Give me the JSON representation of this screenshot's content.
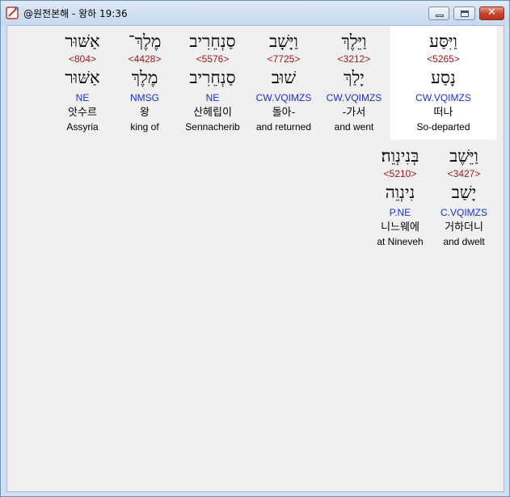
{
  "window": {
    "title": "@원전본해 - 왕하 19:36",
    "close_glyph": "✕"
  },
  "verse_words": [
    {
      "hebrew": "וַיִּסַּע",
      "strong": "<5265>",
      "lemma": "נָסַע",
      "morph": "CW.VQIMZS",
      "korean": "떠나",
      "english": "So-departed"
    },
    {
      "hebrew": "וַיֵּלֶךְ",
      "strong": "<3212>",
      "lemma": "יָלַךְ",
      "morph": "CW.VQIMZS",
      "korean": "-가서",
      "english": "and went"
    },
    {
      "hebrew": "וַיָּשָׁב",
      "strong": "<7725>",
      "lemma": "שׁוּב",
      "morph": "CW.VQIMZS",
      "korean": "돌아-",
      "english": "and returned"
    },
    {
      "hebrew": "סַנְחֵרִיב",
      "strong": "<5576>",
      "lemma": "סַנְחֵרִיב",
      "morph": "NE",
      "korean": "산헤립이",
      "english": "Sennacherib"
    },
    {
      "hebrew": "מֶלֶךְ־",
      "strong": "<4428>",
      "lemma": "מֶלֶךְ",
      "morph": "NMSG",
      "korean": "왕",
      "english": "king of"
    },
    {
      "hebrew": "אַשּׁוּר",
      "strong": "<804>",
      "lemma": "אַשּׁוּר",
      "morph": "NE",
      "korean": "앗수르",
      "english": "Assyria"
    },
    {
      "hebrew": "וַיֵּשֶׁב",
      "strong": "<3427>",
      "lemma": "יָשַׁב",
      "morph": "C.VQIMZS",
      "korean": "거하더니",
      "english": "and dwelt"
    },
    {
      "hebrew": "בְּנִינְוֵה׃",
      "strong": "<5210>",
      "lemma": "נִינְוֵה",
      "morph": "P.NE",
      "korean": "니느웨에",
      "english": "at Nineveh"
    }
  ],
  "colors": {
    "strong_number": "#a01818",
    "morphology": "#1a2fd0",
    "selected_word_background": "#ffffff",
    "client_background": "#f0f0f0"
  }
}
